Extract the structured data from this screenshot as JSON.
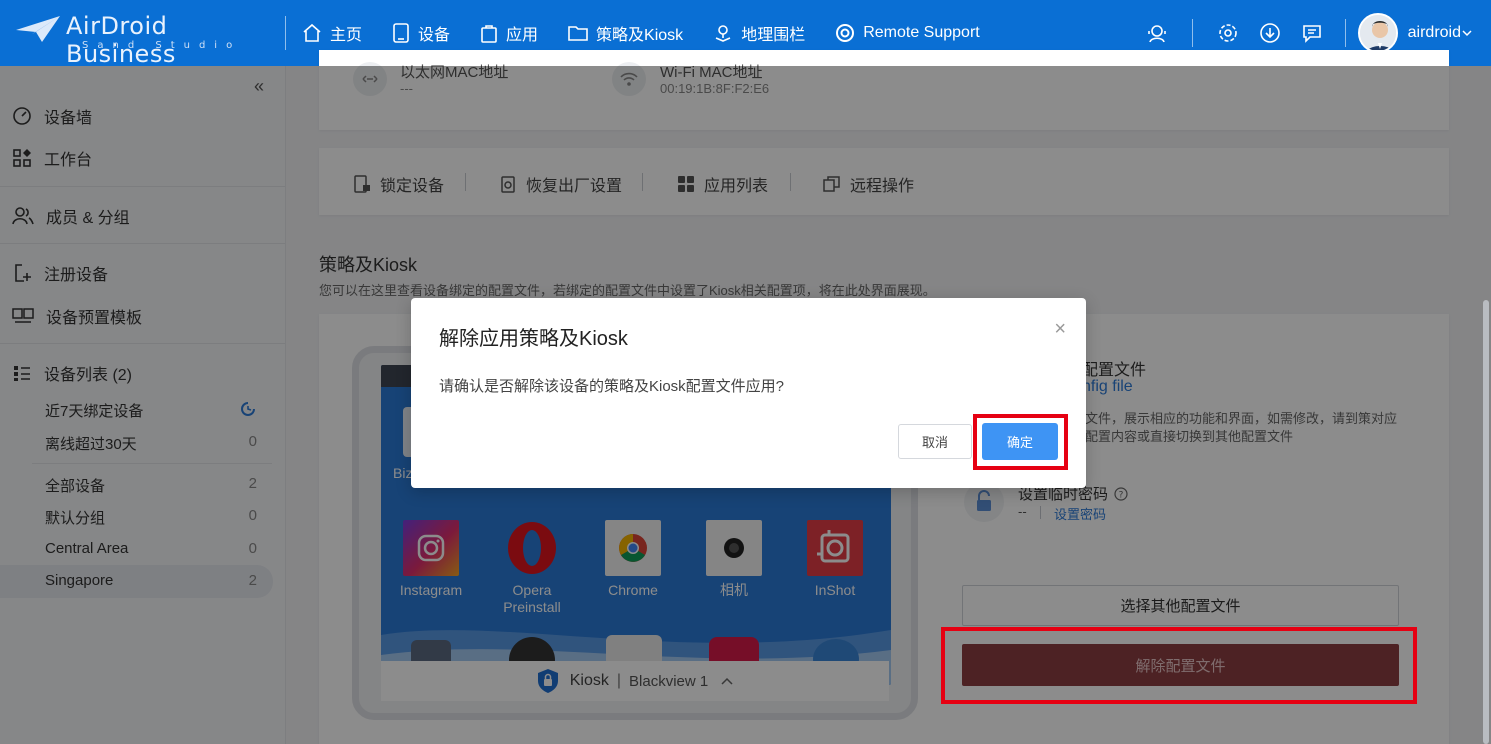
{
  "app": {
    "brand": "AirDroid Business",
    "brand_sub": "Sand Studio",
    "username": "airdroid"
  },
  "nav": {
    "items": [
      {
        "label": "主页",
        "icon": "home-icon"
      },
      {
        "label": "设备",
        "icon": "tablet-icon"
      },
      {
        "label": "应用",
        "icon": "bag-icon"
      },
      {
        "label": "策略及Kiosk",
        "icon": "folder-icon"
      },
      {
        "label": "地理围栏",
        "icon": "map-pin-icon"
      },
      {
        "label": "Remote Support",
        "icon": "lifebuoy-icon"
      }
    ]
  },
  "sidebar": {
    "items": [
      {
        "label": "设备墙",
        "icon": "dashboard-icon"
      },
      {
        "label": "工作台",
        "icon": "grid-icon"
      },
      {
        "label": "成员 & 分组",
        "icon": "users-icon"
      },
      {
        "label": "注册设备",
        "icon": "add-device-icon"
      },
      {
        "label": "设备预置模板",
        "icon": "template-icon"
      },
      {
        "label": "设备列表 (2)",
        "icon": "list-icon"
      }
    ],
    "sub": [
      {
        "label": "近7天绑定设备",
        "count": ""
      },
      {
        "label": "离线超过30天",
        "count": "0"
      },
      {
        "label": "全部设备",
        "count": "2"
      },
      {
        "label": "默认分组",
        "count": "0"
      },
      {
        "label": "Central Area",
        "count": "0"
      },
      {
        "label": "Singapore",
        "count": "2"
      }
    ]
  },
  "info": {
    "eth_label": "以太网MAC地址",
    "eth_value": "---",
    "wifi_label": "Wi-Fi MAC地址",
    "wifi_value": "00:19:1B:8F:F2:E6"
  },
  "actions": [
    "锁定设备",
    "恢复出厂设置",
    "应用列表",
    "远程操作"
  ],
  "section": {
    "title": "策略及Kiosk",
    "desc": "您可以在这里查看设备绑定的配置文件，若绑定的配置文件中设置了Kiosk相关配置项，将在此处界面展现。"
  },
  "device": {
    "partial_label": "Biz",
    "apps": [
      "Instagram",
      "Opera Preinstall",
      "Chrome",
      "相机",
      "InShot"
    ],
    "kiosk_label": "Kiosk",
    "model": "Blackview 1"
  },
  "profile": {
    "title_partial": "配置文件",
    "link_partial": "nfig file",
    "desc_partial": "置文件，展示相应的功能和界面，如需修改，请到策对应的配置内容或直接切换到其他配置文件",
    "pwd_title": "设置临时密码",
    "pwd_value": "--",
    "pwd_link": "设置密码",
    "select_btn": "选择其他配置文件",
    "remove_btn": "解除配置文件"
  },
  "modal": {
    "title": "解除应用策略及Kiosk",
    "body": "请确认是否解除该设备的策略及Kiosk配置文件应用?",
    "cancel": "取消",
    "ok": "确定"
  }
}
